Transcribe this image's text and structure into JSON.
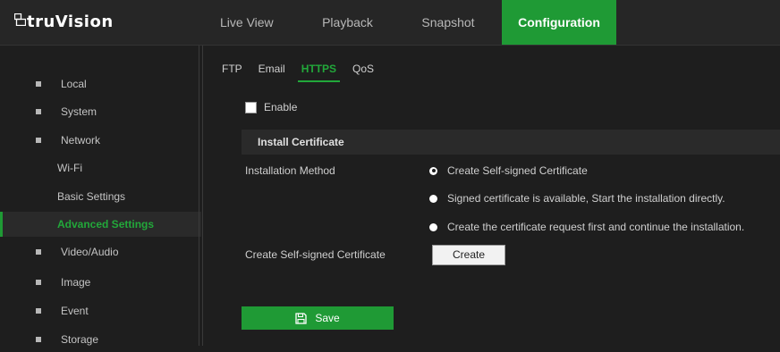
{
  "brand": {
    "name": "truVision"
  },
  "nav": {
    "items": [
      {
        "label": "Live View",
        "active": false
      },
      {
        "label": "Playback",
        "active": false
      },
      {
        "label": "Snapshot",
        "active": false
      },
      {
        "label": "Configuration",
        "active": true
      }
    ]
  },
  "sidebar": {
    "items": [
      {
        "label": "Local",
        "bullet": true
      },
      {
        "label": "System",
        "bullet": true
      },
      {
        "label": "Network",
        "bullet": true
      },
      {
        "label": "Wi-Fi",
        "bullet": false
      },
      {
        "label": "Basic Settings",
        "bullet": false
      },
      {
        "label": "Advanced Settings",
        "bullet": false,
        "active": true
      },
      {
        "label": "Video/Audio",
        "bullet": true
      },
      {
        "label": "Image",
        "bullet": true
      },
      {
        "label": "Event",
        "bullet": true
      },
      {
        "label": "Storage",
        "bullet": true
      }
    ]
  },
  "tabs": [
    {
      "label": "FTP",
      "active": false
    },
    {
      "label": "Email",
      "active": false
    },
    {
      "label": "HTTPS",
      "active": true
    },
    {
      "label": "QoS",
      "active": false
    }
  ],
  "enable": {
    "label": "Enable",
    "checked": false
  },
  "section": {
    "title": "Install Certificate"
  },
  "install_method": {
    "label": "Installation Method",
    "options": [
      {
        "label": "Create Self-signed Certificate",
        "selected": true
      },
      {
        "label": "Signed certificate is available, Start the installation directly.",
        "selected": false
      },
      {
        "label": "Create the certificate request first and continue the installation.",
        "selected": false
      }
    ]
  },
  "self_signed": {
    "label": "Create Self-signed Certificate",
    "button": "Create"
  },
  "save": {
    "label": "Save"
  },
  "colors": {
    "accent": "#1f9a35",
    "background": "#1e1e1e"
  }
}
